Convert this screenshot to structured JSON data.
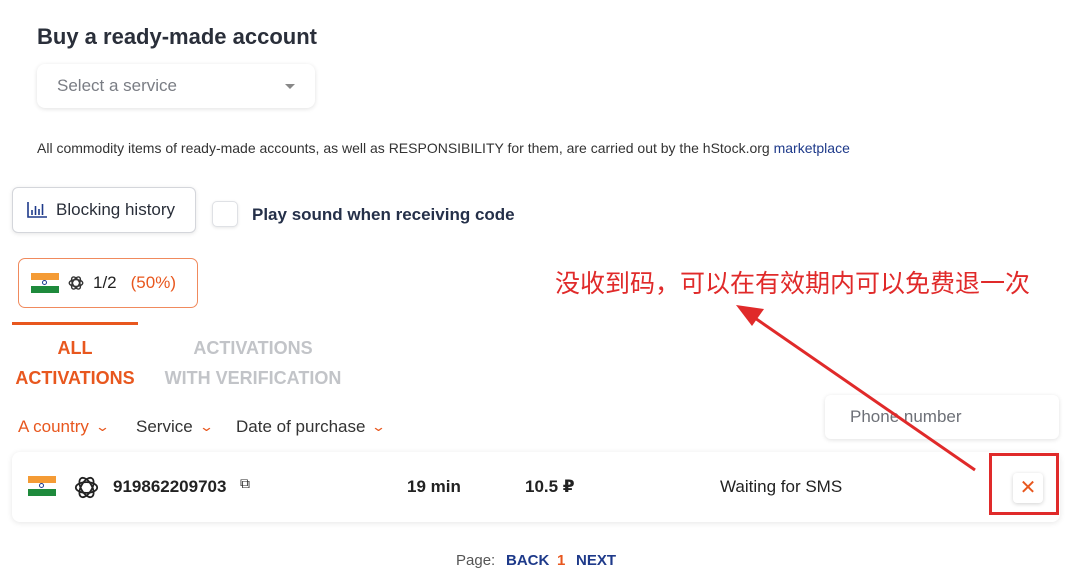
{
  "header": {
    "title": "Buy a ready-made account"
  },
  "service_select": {
    "placeholder": "Select a service"
  },
  "notice": {
    "text": "All commodity items of ready-made accounts, as well as RESPONSIBILITY for them, are carried out by the hStock.org",
    "link": "marketplace"
  },
  "controls": {
    "blocking_history_label": "Blocking history",
    "sound_label": "Play sound when receiving code",
    "sound_checked": false
  },
  "stats": {
    "count": "1/2",
    "percent": "(50%)"
  },
  "tabs": [
    {
      "line1": "ALL",
      "line2": "ACTIVATIONS",
      "active": true
    },
    {
      "line1": "ACTIVATIONS",
      "line2": "WITH VERIFICATION",
      "active": false
    }
  ],
  "filters": {
    "country": "A country",
    "service": "Service",
    "date": "Date of purchase",
    "phone_placeholder": "Phone number"
  },
  "activations": [
    {
      "country_icon": "india-flag-icon",
      "service_icon": "openai-icon",
      "phone": "919862209703",
      "time": "19 min",
      "price": "10.5 ₽",
      "status": "Waiting for SMS"
    }
  ],
  "annotation": {
    "text": "没收到码，可以在有效期内可以免费退一次",
    "color": "#e02a2a"
  },
  "pagination": {
    "label": "Page:",
    "back": "BACK",
    "current": "1",
    "next": "NEXT"
  },
  "colors": {
    "accent": "#e8571e",
    "annotation": "#e02a2a",
    "link": "#1e3a8a"
  }
}
